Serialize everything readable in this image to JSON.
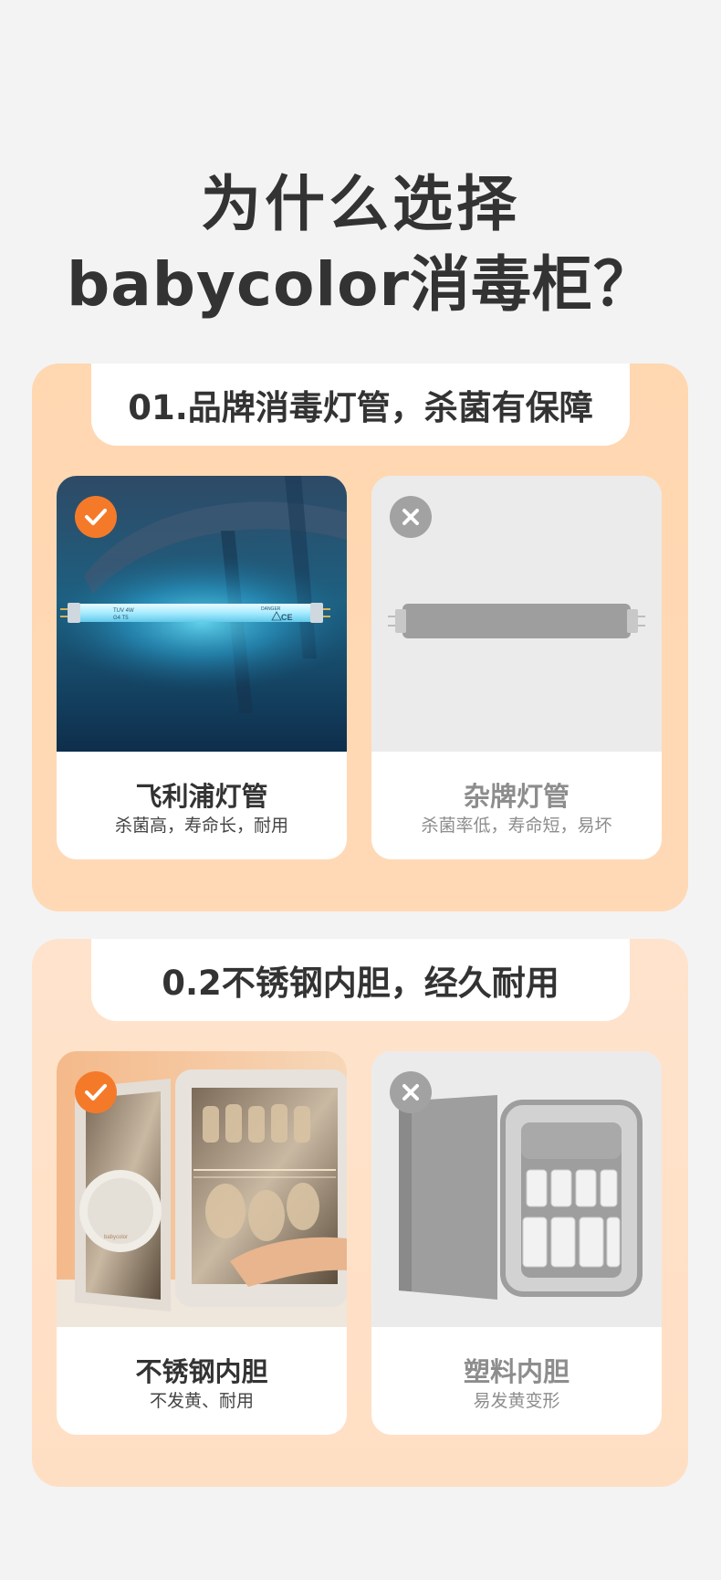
{
  "heading": {
    "line1": "为什么选择",
    "line2": "babycolor消毒柜？"
  },
  "sections": [
    {
      "title": "01.品牌消毒灯管，杀菌有保障",
      "good": {
        "name": "飞利浦灯管",
        "desc": "杀菌高，寿命长，耐用",
        "icon": "check-icon"
      },
      "bad": {
        "name": "杂牌灯管",
        "desc": "杀菌率低，寿命短，易坏",
        "icon": "close-icon"
      },
      "tube_label": {
        "left1": "TUV 4W",
        "left2": "G4 T5",
        "right1": "DANGER",
        "mid": "CE"
      }
    },
    {
      "title": "0.2不锈钢内胆，经久耐用",
      "good": {
        "name": "不锈钢内胆",
        "desc": "不发黄、耐用",
        "icon": "check-icon"
      },
      "bad": {
        "name": "塑料内胆",
        "desc": "易发黄变形",
        "icon": "close-icon"
      },
      "brand_mark": "babycolor"
    }
  ],
  "colors": {
    "accent": "#f47a2a",
    "section1_bg": "#ffd7b1",
    "section2_bg": "#ffe3cc",
    "muted": "#a2a2a2"
  }
}
